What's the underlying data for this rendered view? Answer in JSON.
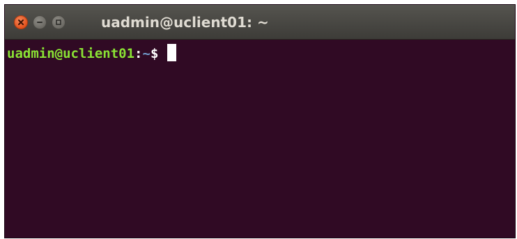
{
  "window": {
    "title": "uadmin@uclient01: ~",
    "buttons": {
      "close_icon": "close-icon",
      "minimize_icon": "minimize-icon",
      "maximize_icon": "maximize-icon"
    }
  },
  "terminal": {
    "prompt_user_host": "uadmin@uclient01",
    "prompt_separator": ":",
    "prompt_path": "~",
    "prompt_symbol": "$",
    "input": ""
  },
  "colors": {
    "background": "#300a24",
    "prompt_user_host": "#8ae234",
    "prompt_path": "#729fcf",
    "close_button": "#e1511c"
  }
}
